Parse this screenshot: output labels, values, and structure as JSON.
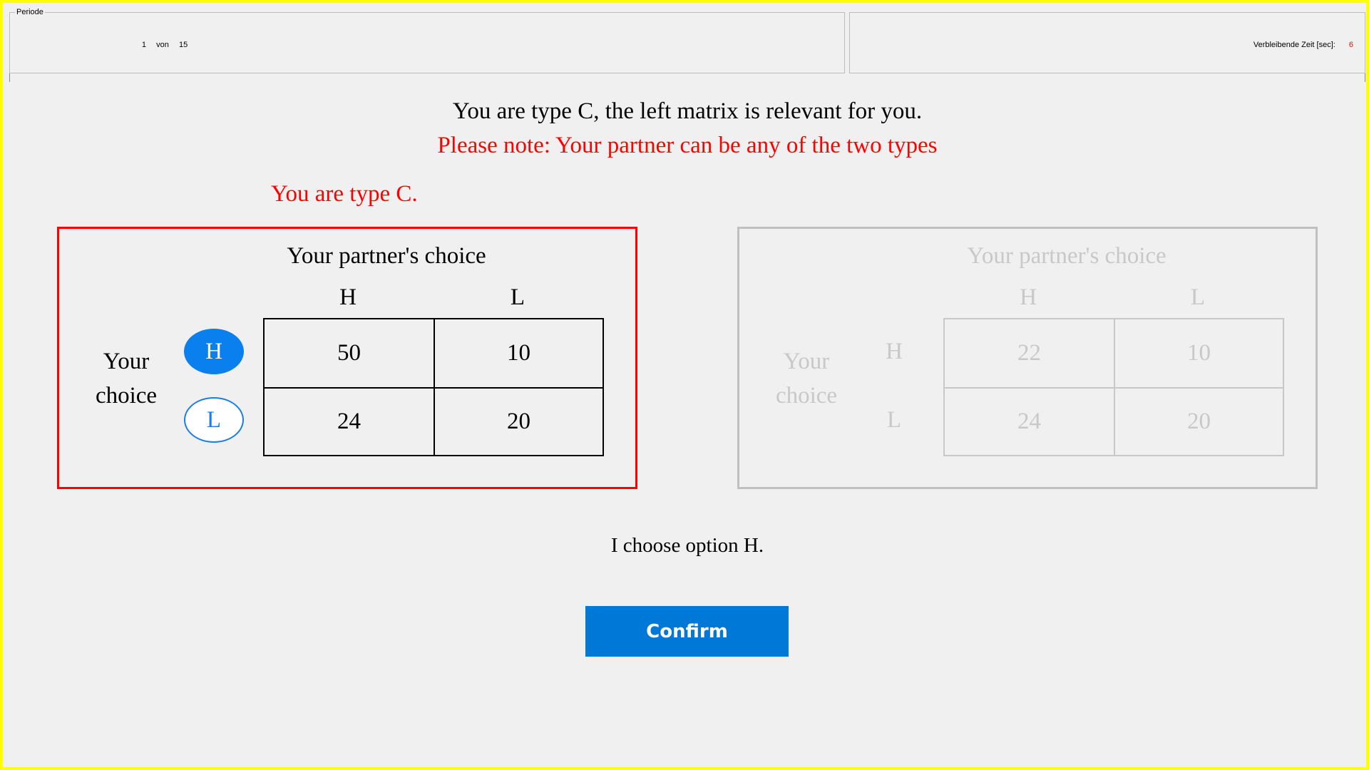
{
  "header": {
    "period_legend": "Periode",
    "period_current": "1",
    "period_von": "von",
    "period_total": "15",
    "time_label": "Verbleibende Zeit [sec]:",
    "time_value": "6"
  },
  "instructions": {
    "line1": "You are type C, the left matrix is relevant for you.",
    "line2": "Please note: Your partner can be any of the two types",
    "type_label": "You are type C."
  },
  "matrix_left": {
    "title": "Your partner's choice",
    "col_headers": [
      "H",
      "L"
    ],
    "row_label_line1": "Your",
    "row_label_line2": "choice",
    "row_options": [
      "H",
      "L"
    ],
    "selected_option": "H",
    "cells": [
      [
        "50",
        "10"
      ],
      [
        "24",
        "20"
      ]
    ]
  },
  "matrix_right": {
    "title": "Your partner's choice",
    "col_headers": [
      "H",
      "L"
    ],
    "row_label_line1": "Your",
    "row_label_line2": "choice",
    "row_options": [
      "H",
      "L"
    ],
    "cells": [
      [
        "22",
        "10"
      ],
      [
        "24",
        "20"
      ]
    ]
  },
  "choice_text": "I choose option H.",
  "confirm_label": "Confirm",
  "colors": {
    "frame": "#ffff00",
    "alert": "#ff0000",
    "accent": "#0078d7",
    "disabled": "#c8c8c8"
  }
}
